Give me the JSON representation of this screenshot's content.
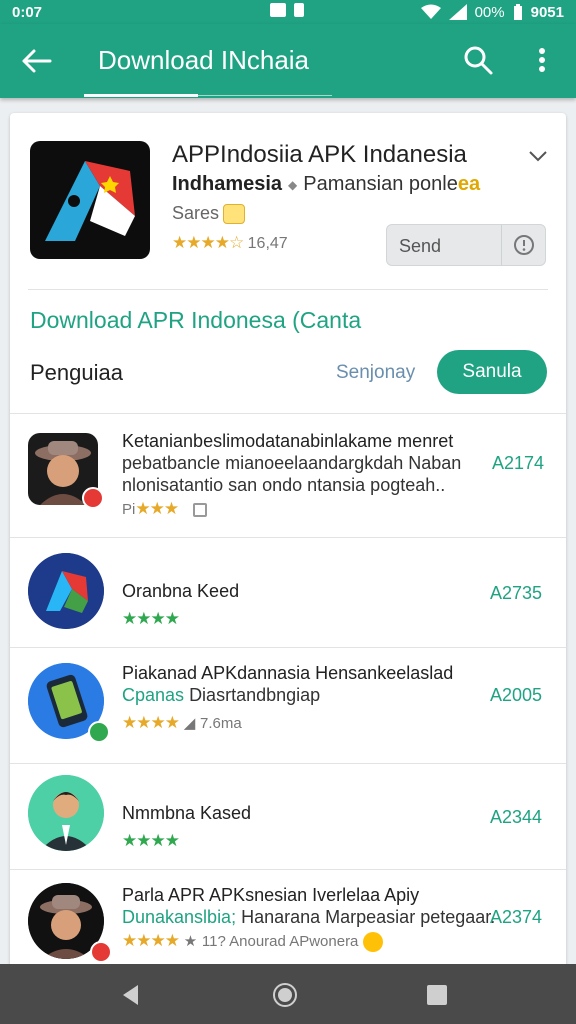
{
  "status_bar": {
    "time": "0:07",
    "battery_text": "00%",
    "right_text": "9051"
  },
  "app_bar": {
    "title": "Download INchaia",
    "back_icon": "arrow-left-icon",
    "search_icon": "search-icon",
    "more_icon": "more-vert-icon"
  },
  "app": {
    "title": "APPIndosiia APK Indanesia",
    "developer": "Indhamesia",
    "category": "Pamansian ponle",
    "category_suffix": "ea",
    "label": "Sares",
    "rating_count": "16,47",
    "stars": 3.5,
    "send_label": "Send"
  },
  "section": {
    "download_text": "Download APR Indonesa (Canta",
    "left_label": "Penguiaa",
    "link_label": "Senjonay",
    "button_label": "Sanula"
  },
  "rows": [
    {
      "line1": "Ketanianbeslimodatanabinlakame menret",
      "line2": "pebatbancle mianoeelaandargkdah Naban",
      "line3": "nlonisatantio san ondo ntansia pogteah..",
      "meta": "Pi",
      "price": "A2174",
      "stars": 3
    },
    {
      "line1": "Oranbna Keed",
      "price": "A2735",
      "stars": 4
    },
    {
      "line1": "Piakanad APKdannasia Hensankeelaslad",
      "line2_green": "Cpanas",
      "line2": "Diasrtandbngiap",
      "meta": "7.6ma",
      "price": "A2005",
      "stars": 4
    },
    {
      "line1": "Nmmbna Kased",
      "price": "A2344",
      "stars": 4
    },
    {
      "line1": "Parla APR APKsnesian Iverlelaa Apiy",
      "line2_green": "Dunakanslbia;",
      "line2": "Hanarana Marpeasiar petegaar.",
      "meta": "11? Anourad APwonera",
      "price": "A2374",
      "stars": 3.5
    }
  ],
  "nav": {
    "back": "nav-back-icon",
    "home": "nav-home-icon",
    "recents": "nav-recents-icon"
  }
}
